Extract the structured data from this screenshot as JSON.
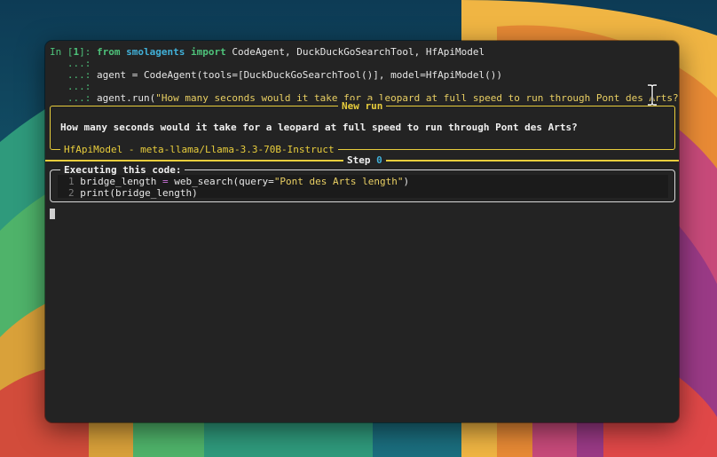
{
  "colors": {
    "prompt_green": "#4ec27a",
    "keyword_blue": "#41b0d8",
    "box_yellow": "#e8cd3c",
    "string_yellow": "#e9cf63",
    "text": "#e6e6e6",
    "terminal_bg": "#232323"
  },
  "prompt": {
    "in_label": "In [",
    "in_number": "1",
    "in_close": "]:",
    "continuation": "...:"
  },
  "code_lines": {
    "line1": {
      "kw_from": "from",
      "module": "smolagents",
      "kw_import": "import",
      "names": "CodeAgent, DuckDuckGoSearchTool, HfApiModel"
    },
    "line2": {
      "text": "agent = CodeAgent(tools=[DuckDuckGoSearchTool()], model=HfApiModel())"
    },
    "line3": {
      "call": "agent.run(",
      "arg": "\"How many seconds would it take for a leopard at full speed to run through Pont des Arts?\"",
      "close": ")"
    }
  },
  "new_run_box": {
    "title": "New run",
    "task": "How many seconds would it take for a leopard at full speed to run through Pont des Arts?",
    "model_footer": "HfApiModel - meta-llama/Llama-3.3-70B-Instruct"
  },
  "step": {
    "label": "Step",
    "number": "0"
  },
  "exec_box": {
    "title": "Executing this code:",
    "lines": [
      {
        "num": "1",
        "pre": "bridge_length ",
        "eq": "=",
        "mid": " web_search(query=",
        "str": "\"Pont des Arts length\"",
        "post": ")"
      },
      {
        "num": "2",
        "text": "print(bridge_length)"
      }
    ]
  },
  "icons": {
    "text_cursor": "i-beam-cursor-icon",
    "block_cursor": "block-cursor-icon"
  }
}
